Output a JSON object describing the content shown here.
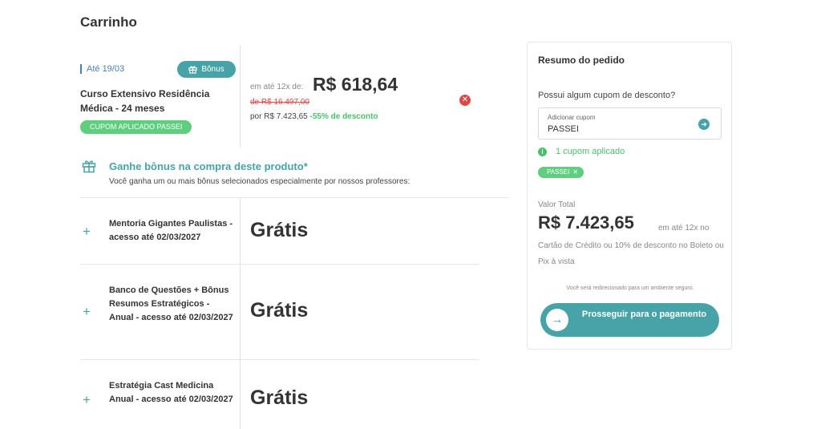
{
  "page": {
    "title": "Carrinho"
  },
  "product": {
    "deadline": "Até 19/03",
    "bonus_badge": "Bônus",
    "name": "Curso Extensivo Residência Médica - 24 meses",
    "coupon_tag": "CUPOM APLICADO PASSEI",
    "installment_prefix": "em até 12x de:",
    "installment_price": "R$ 618,64",
    "old_price": "de R$ 16.497,00",
    "total_prefix": "por R$ 7.423,65",
    "discount": "-55% de desconto"
  },
  "bonus": {
    "title": "Ganhe bônus na compra deste produto*",
    "description": "Você ganha um ou mais bônus selecionados especialmente por nossos professores:",
    "items": [
      {
        "name": "Mentoria Gigantes Paulistas - acesso até 02/03/2027",
        "price": "Grátis"
      },
      {
        "name": "Banco de Questões + Bônus Resumos Estratégicos - Anual - acesso até 02/03/2027",
        "price": "Grátis"
      },
      {
        "name": "Estratégia Cast Medicina Anual - acesso até 02/03/2027",
        "price": "Grátis"
      }
    ]
  },
  "summary": {
    "title": "Resumo do pedido",
    "coupon_question": "Possui algum cupom de desconto?",
    "coupon_input_label": "Adicionar cupom",
    "coupon_input_value": "PASSEI",
    "applied_text": "1 cupom aplicado",
    "chip_label": "PASSEI",
    "total_label": "Valor Total",
    "total_value": "R$ 7.423,65",
    "total_suffix": "em até 12x no",
    "total_detail": "Cartão de Crédito ou 10% de desconto no Boleto ou Pix à vista",
    "redirect_note": "Você será redirecionado para um ambiente seguro.",
    "proceed_label": "Prosseguir para o pagamento"
  },
  "colors": {
    "accent": "#48a3a8",
    "success": "#5fce7e",
    "danger": "#e04848"
  }
}
